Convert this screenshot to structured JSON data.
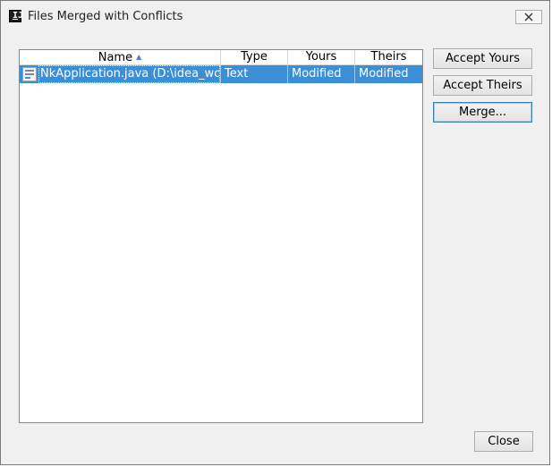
{
  "window": {
    "title": "Files Merged with Conflicts"
  },
  "table": {
    "columns": [
      "Name",
      "Type",
      "Yours",
      "Theirs"
    ],
    "sort_indicator": "sort-ascending-icon",
    "rows": [
      {
        "name": "NkApplication.java (D:\\idea_worksp",
        "type": "Text",
        "yours": "Modified",
        "theirs": "Modified",
        "icon": "java-file-icon",
        "selected": true
      }
    ]
  },
  "buttons": {
    "accept_yours": "Accept Yours",
    "accept_theirs": "Accept Theirs",
    "merge": "Merge...",
    "close": "Close"
  },
  "colors": {
    "selection": "#3a8fd6",
    "window_bg": "#f0f0f0"
  }
}
